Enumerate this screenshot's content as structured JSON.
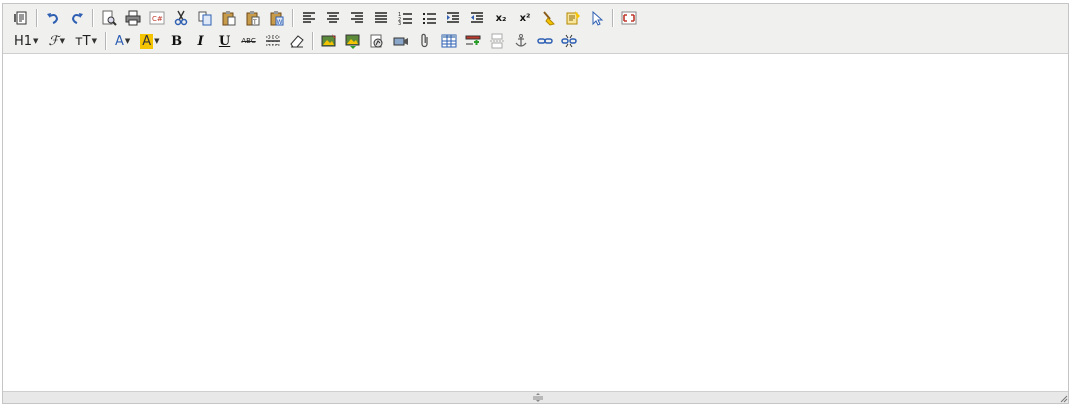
{
  "toolbar": {
    "heading_label": "H1",
    "font_label": "ℱ",
    "size_label": "ᴛT",
    "font_color_label": "A",
    "bg_color_label": "A",
    "bold_label": "B",
    "italic_label": "I",
    "underline_label": "U",
    "strike_label": "ABC",
    "subscript_label": "x₂",
    "superscript_label": "x²",
    "colors": {
      "accent_blue": "#2e5fb3",
      "highlight_yellow": "#f5c400",
      "toolbar_bg": "#f0f0ee",
      "fullscreen_red": "#c0392b"
    }
  },
  "editor": {
    "content": ""
  }
}
